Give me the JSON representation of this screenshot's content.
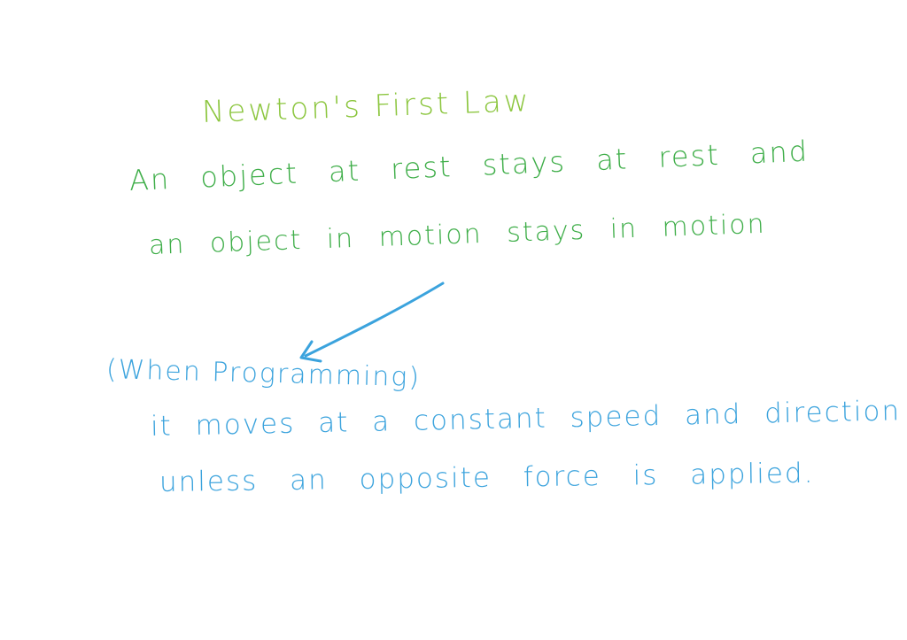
{
  "note": {
    "title": "Newton's First Law",
    "law_line_1": "An object at rest stays at rest and",
    "law_line_2": "an object in motion stays in motion",
    "context_label": "(When Programming)",
    "explanation_line_1": "it moves at a constant speed and direction",
    "explanation_line_2": "unless an opposite force is applied."
  },
  "colors": {
    "background": "#ffffff",
    "title_green": "#8cc63f",
    "law_green": "#3fae49",
    "blue_ink": "#3ba3dd"
  },
  "icons": {
    "arrow": "curved-arrow-icon"
  }
}
